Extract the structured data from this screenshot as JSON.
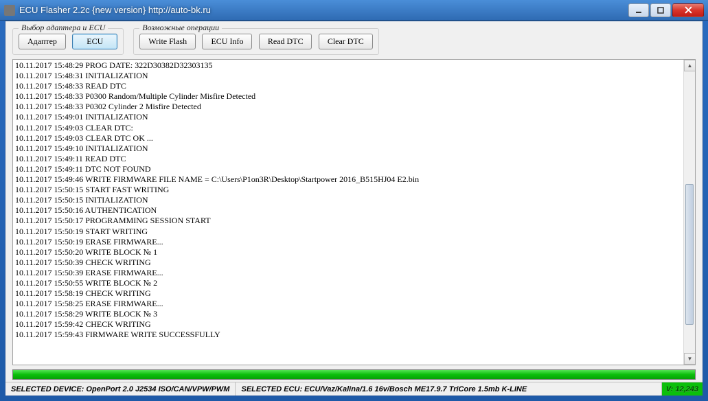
{
  "window": {
    "title": "ECU Flasher 2.2c {new version} http://auto-bk.ru"
  },
  "groups": {
    "adapter": {
      "legend": "Выбор адаптера и ECU",
      "btn_adapter": "Адаптер",
      "btn_ecu": "ECU"
    },
    "ops": {
      "legend": "Возможные операции",
      "btn_write": "Write Flash",
      "btn_info": "ECU Info",
      "btn_read_dtc": "Read DTC",
      "btn_clear_dtc": "Clear DTC"
    }
  },
  "log": [
    "10.11.2017 15:48:29 PROG DATE: 322D30382D32303135",
    "10.11.2017 15:48:31 INITIALIZATION",
    "10.11.2017 15:48:33 READ DTC",
    "10.11.2017 15:48:33 P0300 Random/Multiple Cylinder Misfire Detected",
    "10.11.2017 15:48:33 P0302 Cylinder 2 Misfire Detected",
    "10.11.2017 15:49:01 INITIALIZATION",
    "10.11.2017 15:49:03 CLEAR DTC:",
    "10.11.2017 15:49:03 CLEAR DTC OK ...",
    "10.11.2017 15:49:10 INITIALIZATION",
    "10.11.2017 15:49:11 READ DTC",
    "10.11.2017 15:49:11 DTC NOT FOUND",
    "10.11.2017 15:49:46 WRITE FIRMWARE FILE NAME = C:\\Users\\P1on3R\\Desktop\\Startpower 2016_B515HJ04 E2.bin",
    "10.11.2017 15:50:15 START FAST WRITING",
    "10.11.2017 15:50:15 INITIALIZATION",
    "10.11.2017 15:50:16 AUTHENTICATION",
    "10.11.2017 15:50:17 PROGRAMMING SESSION START",
    "10.11.2017 15:50:19 START WRITING",
    "10.11.2017 15:50:19 ERASE FIRMWARE...",
    "10.11.2017 15:50:20 WRITE BLOCK № 1",
    "10.11.2017 15:50:39 CHECK WRITING",
    "10.11.2017 15:50:39 ERASE FIRMWARE...",
    "10.11.2017 15:50:55 WRITE BLOCK № 2",
    "10.11.2017 15:58:19 CHECK WRITING",
    "10.11.2017 15:58:25 ERASE FIRMWARE...",
    "10.11.2017 15:58:29 WRITE BLOCK № 3",
    "10.11.2017 15:59:42 CHECK WRITING",
    "10.11.2017 15:59:43 FIRMWARE WRITE SUCCESSFULLY"
  ],
  "progress": {
    "percent": 100
  },
  "status": {
    "device_label": "SELECTED DEVICE:",
    "device_value": "OpenPort 2.0 J2534 ISO/CAN/VPW/PWM",
    "ecu_label": "SELECTED ECU:",
    "ecu_value": "ECU/Vaz/Kalina/1.6 16v/Bosch ME17.9.7 TriCore 1.5mb K-LINE",
    "version": "V: 12,243"
  }
}
